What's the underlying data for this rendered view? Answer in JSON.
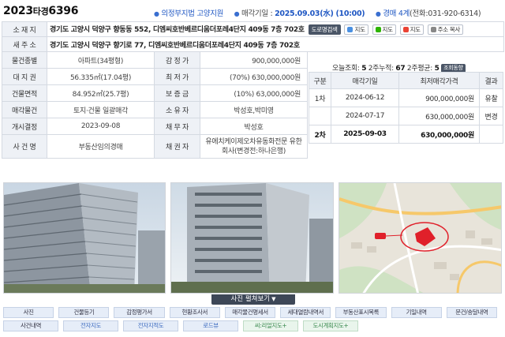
{
  "case": {
    "year": "2023",
    "type": "타경",
    "number": "6396"
  },
  "header": {
    "court": "의정부지법 고양지원",
    "sale_date_label": "매각기일 :",
    "sale_date": "2025.09.03(水) (10:00)",
    "dept": "경매 4계",
    "phone": "(전화:031-920-6314)"
  },
  "address": {
    "jibun_label": "소 재 지",
    "jibun": "경기도 고양시 덕양구 향동동 552, 디엠씨호반베르디움더포레4단지 409동 7층 702호",
    "road_label": "새 주 소",
    "road": "경기도 고양시 덕양구 향기로 77, 디엠씨호반베르디움더포레4단지 409동 7층 702호",
    "buttons": {
      "roadview": "도로명검색",
      "daum_map": "지도",
      "naver_map": "지도",
      "google_map": "지도",
      "copy": "주소 복사"
    }
  },
  "details": {
    "type_label": "물건종별",
    "type_value": "아파트(34평형)",
    "appraisal_label": "감 정 가",
    "appraisal_value": "900,000,000원",
    "land_label": "대 지 권",
    "land_value": "56.335㎡(17.04평)",
    "min_price_label": "최 저 가",
    "min_price_value": "(70%) 630,000,000원",
    "building_label": "건물면적",
    "building_value": "84.952㎡(25.7평)",
    "deposit_label": "보 증 금",
    "deposit_value": "(10%) 63,000,000원",
    "sale_target_label": "매각물건",
    "sale_target_value": "토지·건물 일괄매각",
    "owner_label": "소 유 자",
    "owner_value": "박성호,박미영",
    "start_label": "개시결정",
    "start_value": "2023-09-08",
    "debtor_label": "채 무 자",
    "debtor_value": "박성호",
    "case_name_label": "사 건 명",
    "case_name_value": "부동산임의경매",
    "creditor_label": "채 권 자",
    "creditor_value": "유에치케이제오차유동화전문 유한회사(변경전:하나은행)"
  },
  "stats": {
    "today_label": "오늘조회:",
    "today": "5",
    "two_week_label": "2주누적:",
    "two_week": "67",
    "avg_label": "2주평균:",
    "avg": "5",
    "trend_button": "조회동향"
  },
  "history": {
    "headers": [
      "구분",
      "매각기일",
      "최저매각가격",
      "결과"
    ],
    "rows": [
      {
        "round": "1차",
        "date": "2024-06-12",
        "price": "900,000,000원",
        "result": "유찰"
      },
      {
        "round": "",
        "date": "2024-07-17",
        "price": "630,000,000원",
        "result": "변경"
      },
      {
        "round": "2차",
        "date": "2025-09-03",
        "price": "630,000,000원",
        "result": ""
      }
    ]
  },
  "photo_toggle": "사진 펼쳐보기",
  "buttons_row1": [
    "사진",
    "건물등기",
    "감정평가서",
    "현황조사서",
    "매각물건명세서",
    "세대열람내역서",
    "부동산표시목록",
    "기일내역",
    "문건/송달내역"
  ],
  "buttons_row2": [
    "사건내역",
    "전자지도",
    "전자지적도",
    "로드뷰",
    "씨:리얼지도+",
    "도시계획지도+"
  ],
  "colors": {
    "label_bg": "#eef1f6",
    "accent_blue": "#1f57c3",
    "dark_button": "#4a5566",
    "map_marker": "#e0202a"
  }
}
